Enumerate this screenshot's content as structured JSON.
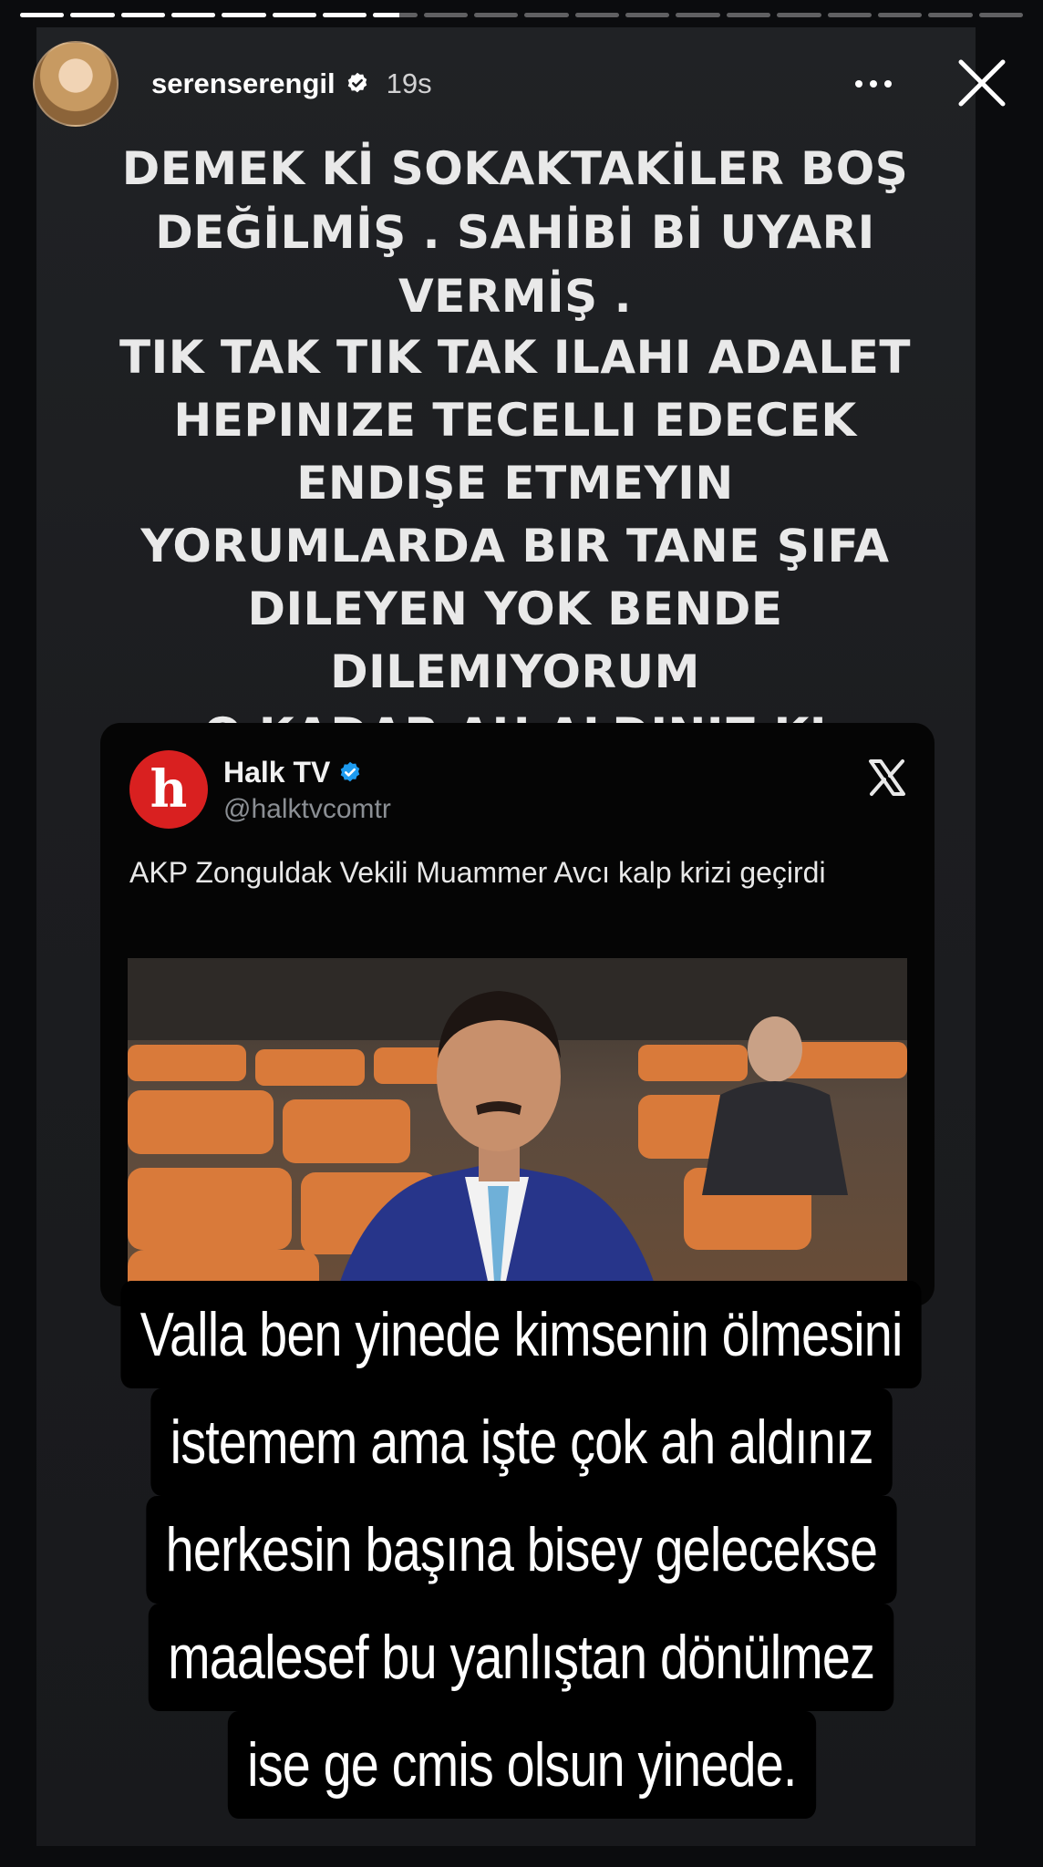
{
  "story": {
    "progress_segments": 20,
    "current_segment": 8,
    "current_segment_progress": 0.6
  },
  "header": {
    "username": "serenserengil",
    "time": "19s"
  },
  "icons": {
    "verified": "verified-badge-icon",
    "more": "more-icon",
    "close": "close-icon",
    "tweet_x": "x-logo-icon"
  },
  "headline": {
    "lines_a": [
      "DEMEK Kİ SOKAKTAKİLER BOŞ",
      "DEĞİLMİŞ . SAHİBİ Bİ UYARI VERMİŞ ."
    ],
    "lines_b": [
      "TIK TAK TIK TAK  ILAHI ADALET",
      "HEPINIZE TECELLI EDECEK",
      "ENDIŞE ETMEYIN",
      "YORUMLARDA BIR TANE ŞIFA",
      "DILEYEN YOK BENDE DILEMIYORUM",
      "O KADAR AH ALDINIZ KI"
    ]
  },
  "tweet": {
    "logo_letter": "h",
    "name": "Halk TV",
    "handle": "@halktvcomtr",
    "text": "AKP Zonguldak Vekili Muammer Avcı kalp krizi geçirdi"
  },
  "caption": {
    "lines": [
      "Valla ben yinede kimsenin ölmesini",
      "istemem ama işte  çok ah aldınız",
      "herkesin başına bisey gelecekse",
      "maalesef bu yanlıştan dönülmez",
      "ise ge cmis olsun yinede."
    ]
  },
  "colors": {
    "brand_red": "#d92020",
    "verified_blue": "#1d9bf0",
    "background": "#0b0c0e"
  }
}
